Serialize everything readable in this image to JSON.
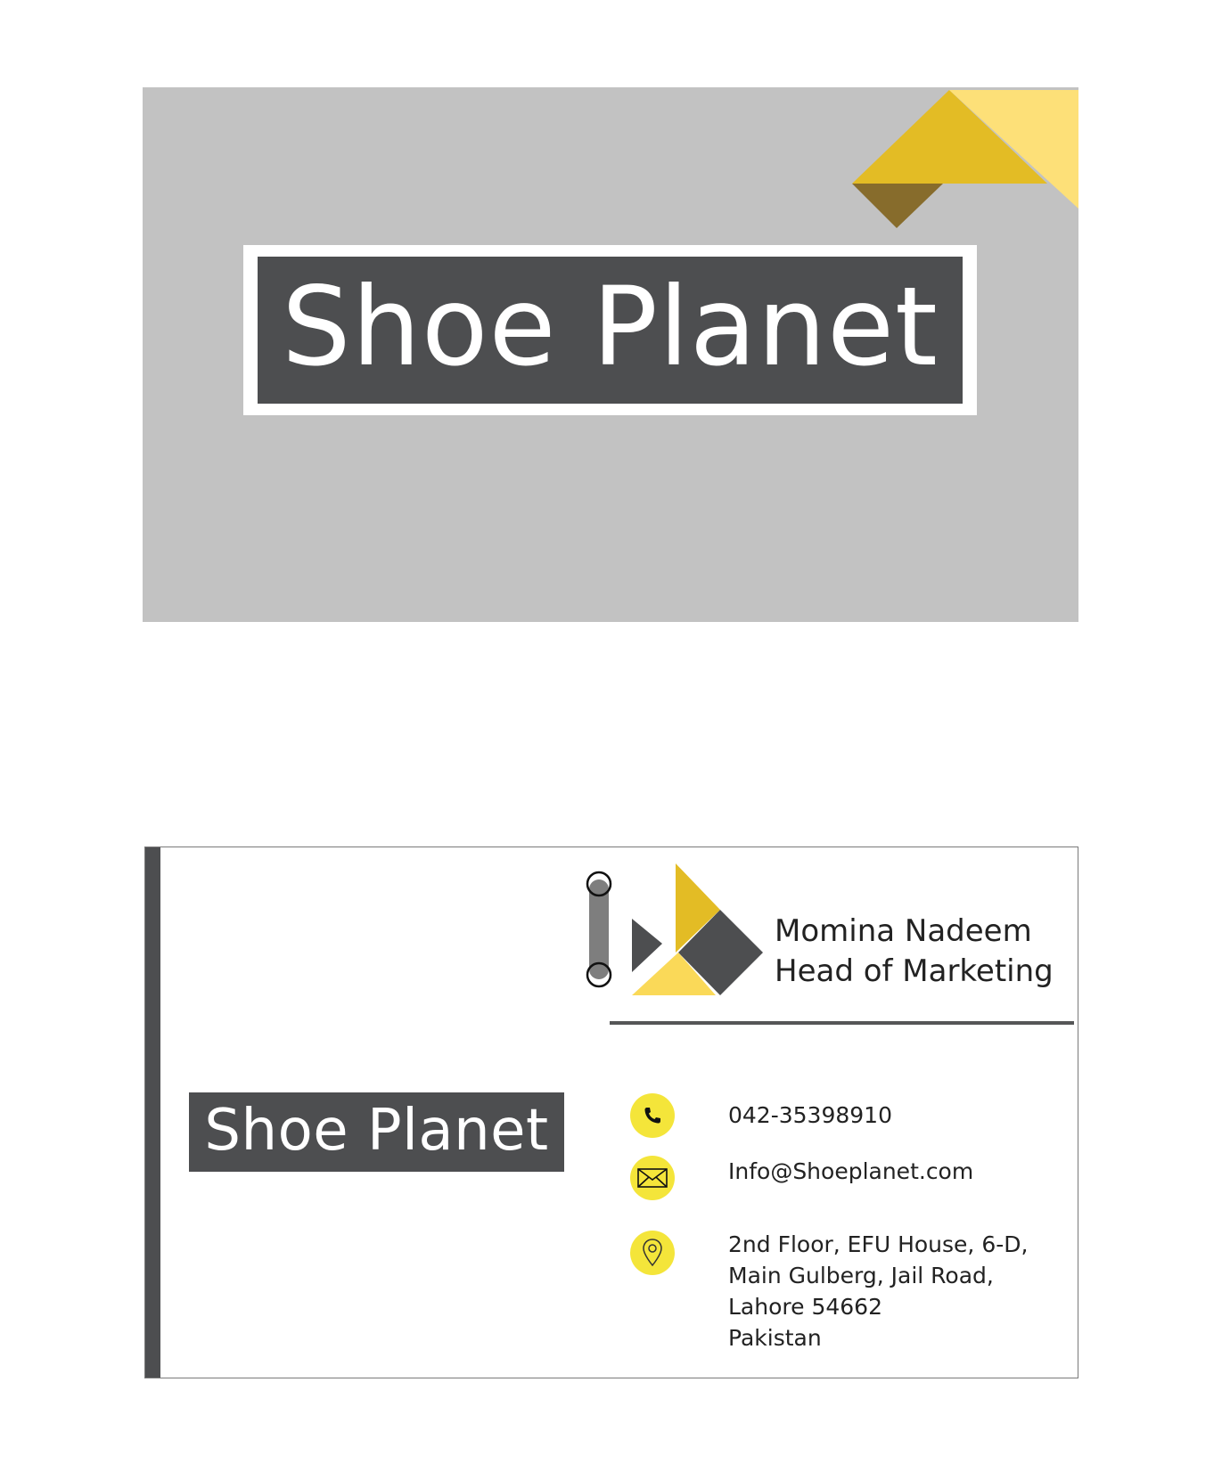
{
  "front": {
    "logo_text": "Shoe Planet"
  },
  "back": {
    "logo_text": "Shoe Planet",
    "name": "Momina Nadeem",
    "title": "Head of Marketing",
    "phone": "042-35398910",
    "email": "Info@Shoeplanet.com",
    "address": [
      "2nd Floor, EFU House, 6-D,",
      "Main Gulberg, Jail Road,",
      "Lahore 54662",
      "Pakistan"
    ],
    "icons": [
      "phone-icon",
      "mail-icon",
      "location-pin-icon"
    ]
  },
  "colors": {
    "card_gray": "#c2c2c2",
    "logo_dark": "#4d4e50",
    "gold": "#e3bc25",
    "light_yellow": "#fde078",
    "dark_gold": "#876c2c",
    "icon_yellow": "#f4e53a"
  }
}
